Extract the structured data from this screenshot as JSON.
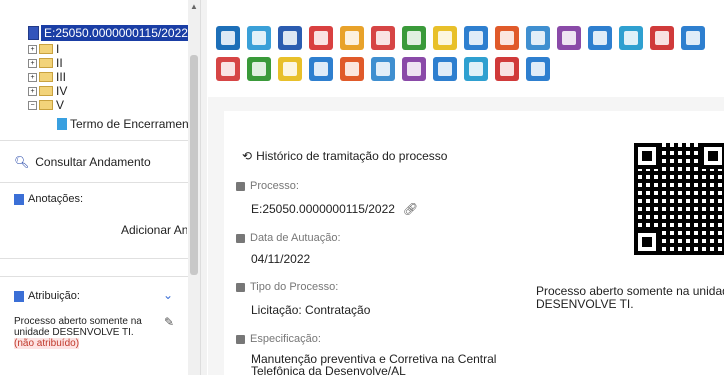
{
  "tree": {
    "process_number": "E:25050.0000000115/2022",
    "nodes": [
      "I",
      "II",
      "III",
      "IV",
      "V"
    ],
    "leaf": "Termo de Encerramento"
  },
  "sidebar": {
    "consultar": "Consultar Andamento",
    "anotacoes": "Anotações:",
    "adicionar": "Adicionar Anotação",
    "atribuicao": "Atribuição:",
    "attr_text": "Processo aberto somente na unidade DESENVOLVE TI.",
    "attr_pill": "(não atribuído)"
  },
  "main": {
    "historico": "Histórico de tramitação do processo",
    "processo_label": "Processo:",
    "processo_value": "E:25050.0000000115/2022",
    "data_label": "Data de Autuação:",
    "data_value": "04/11/2022",
    "tipo_label": "Tipo do Processo:",
    "tipo_value": "Licitação: Contratação",
    "espec_label": "Especificação:",
    "espec_value": "Manutenção preventiva e Corretiva na Central Telefônica da Desenvolve/AL",
    "qr_note": "Processo aberto somente na unidade DESENVOLVE TI."
  },
  "toolbar": {
    "row1_icons": [
      "incluir-documento-icon",
      "iniciar-processo-icon",
      "relacionamento-icon",
      "acompanhamento-icon",
      "credencial-icon",
      "enviar-icon",
      "atualizar-andamento-icon",
      "atribuir-icon",
      "duplicar-icon",
      "enviar-email-icon",
      "relacionar-icon",
      "bloco-icon",
      "gerar-pdf-icon",
      "anotacao-icon",
      "sobrestar-icon",
      "editar-icon"
    ],
    "row2_icons": [
      "excluir-icon",
      "gerar-pdf-icon",
      "gerar-zip-icon",
      "marcador-icon",
      "ponto-controle-icon",
      "comentarios-icon",
      "pesquisar-icon",
      "ciencia-icon",
      "concluir-icon",
      "reabrir-icon",
      "imprimir-icon"
    ],
    "colors": [
      "#1d6fb8",
      "#3aa0d8",
      "#2b5cb0",
      "#d94040",
      "#e8a22a",
      "#d64545",
      "#3a9a3a",
      "#e8c02a",
      "#2e7fcf",
      "#e05a2a",
      "#3f8fd0",
      "#8a4aa8",
      "#2e7fcf",
      "#2fa0d0",
      "#d03a3a",
      "#2e7fcf"
    ]
  }
}
